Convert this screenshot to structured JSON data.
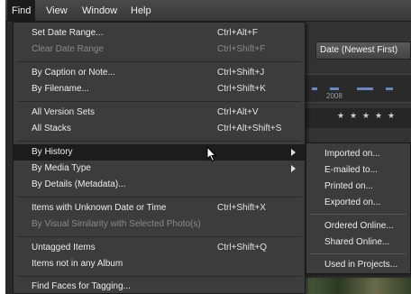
{
  "menubar": {
    "items": [
      {
        "label": "Find"
      },
      {
        "label": "View"
      },
      {
        "label": "Window"
      },
      {
        "label": "Help"
      }
    ]
  },
  "background": {
    "sort_select": "Date (Newest First)",
    "timeline_year": "2008"
  },
  "find_menu": {
    "items": [
      {
        "label": "Set Date Range...",
        "shortcut": "Ctrl+Alt+F",
        "disabled": false
      },
      {
        "label": "Clear Date Range",
        "shortcut": "Ctrl+Shift+F",
        "disabled": true
      },
      {
        "label": "By Caption or Note...",
        "shortcut": "Ctrl+Shift+J",
        "disabled": false
      },
      {
        "label": "By Filename...",
        "shortcut": "Ctrl+Shift+K",
        "disabled": false
      },
      {
        "label": "All Version Sets",
        "shortcut": "Ctrl+Alt+V",
        "disabled": false
      },
      {
        "label": "All Stacks",
        "shortcut": "Ctrl+Alt+Shift+S",
        "disabled": false
      },
      {
        "label": "By History",
        "shortcut": "",
        "disabled": false,
        "submenu": true,
        "highlighted": true
      },
      {
        "label": "By Media Type",
        "shortcut": "",
        "disabled": false,
        "submenu": true
      },
      {
        "label": "By Details (Metadata)...",
        "shortcut": "",
        "disabled": false
      },
      {
        "label": "Items with Unknown Date or Time",
        "shortcut": "Ctrl+Shift+X",
        "disabled": false
      },
      {
        "label": "By Visual Similarity with Selected Photo(s)",
        "shortcut": "",
        "disabled": true
      },
      {
        "label": "Untagged Items",
        "shortcut": "Ctrl+Shift+Q",
        "disabled": false
      },
      {
        "label": "Items not in any Album",
        "shortcut": "",
        "disabled": false
      },
      {
        "label": "Find Faces for Tagging...",
        "shortcut": "",
        "disabled": false
      }
    ]
  },
  "history_submenu": {
    "items": [
      {
        "label": "Imported on..."
      },
      {
        "label": "E-mailed to..."
      },
      {
        "label": "Printed on..."
      },
      {
        "label": "Exported on..."
      },
      {
        "label": "Ordered Online..."
      },
      {
        "label": "Shared Online..."
      },
      {
        "label": "Used in Projects..."
      }
    ]
  }
}
